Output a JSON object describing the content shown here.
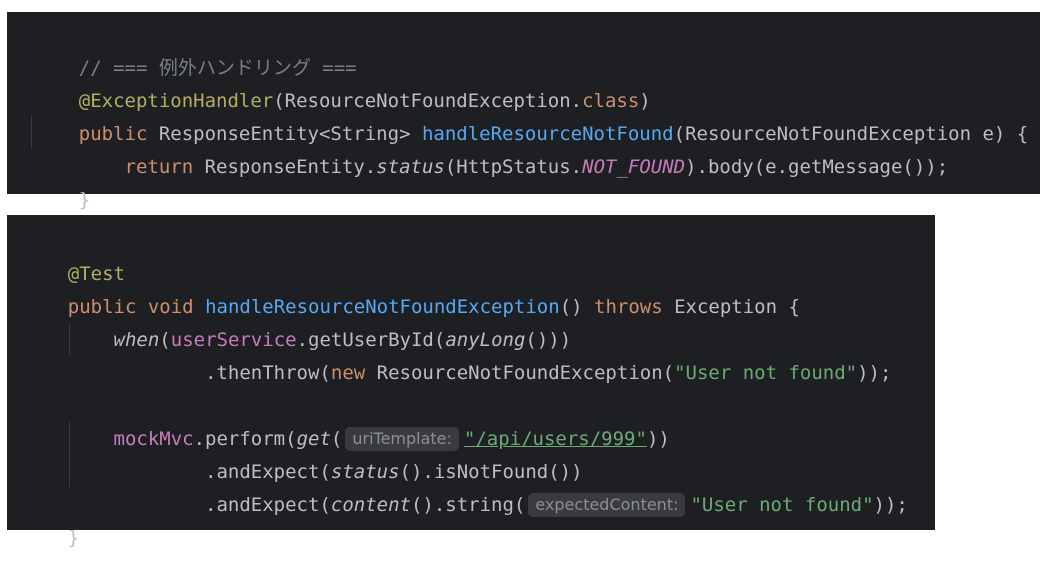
{
  "panel1": {
    "line1": {
      "comment": "// === 例外ハンドリング ==="
    },
    "line2": {
      "annotation": "@ExceptionHandler",
      "open": "(ResourceNotFoundException.",
      "kw_class": "class",
      "close": ")"
    },
    "line3": {
      "kw_public": "public",
      "type": " ResponseEntity<String> ",
      "method": "handleResourceNotFound",
      "params": "(ResourceNotFoundException e) {"
    },
    "line4": {
      "indent": "    ",
      "kw_return": "return",
      "part1": " ResponseEntity.",
      "status": "status",
      "part2": "(HttpStatus.",
      "const": "NOT_FOUND",
      "part3": ").body(e.getMessage());"
    },
    "line5": {
      "brace": "}"
    }
  },
  "panel2": {
    "line1": {
      "annotation": "@Test"
    },
    "line2": {
      "kw_public": "public",
      "sp1": " ",
      "kw_void": "void",
      "sp2": " ",
      "method": "handleResourceNotFoundException",
      "paren": "() ",
      "kw_throws": "throws",
      "rest": " Exception {"
    },
    "line3": {
      "indent": "    ",
      "when": "when",
      "p1": "(",
      "field": "userService",
      "p2": ".getUserById(",
      "anyLong": "anyLong",
      "p3": "()))"
    },
    "line4": {
      "indent": "            ",
      "p1": ".thenThrow(",
      "kw_new": "new",
      "p2": " ResourceNotFoundException(",
      "str": "\"User not found\"",
      "p3": "));"
    },
    "line6": {
      "indent": "    ",
      "field": "mockMvc",
      "p1": ".perform(",
      "get": "get",
      "p2": "(",
      "hint": "uriTemplate:",
      "str": "\"/api/users/999\"",
      "p3": "))"
    },
    "line7": {
      "indent": "            ",
      "p1": ".andExpect(",
      "status": "status",
      "p2": "().isNotFound())"
    },
    "line8": {
      "indent": "            ",
      "p1": ".andExpect(",
      "content": "content",
      "p2": "().string(",
      "hint": "expectedContent:",
      "str": "\"User not found\"",
      "p3": "));"
    },
    "line9": {
      "brace": "}"
    }
  },
  "colors": {
    "background": "#1e1f22",
    "comment": "#7a7e85",
    "annotation": "#b3ae60",
    "keyword": "#cf8e6d",
    "method": "#56a8f5",
    "field": "#c77dbb",
    "string": "#6aab73",
    "text": "#bcbec4"
  }
}
